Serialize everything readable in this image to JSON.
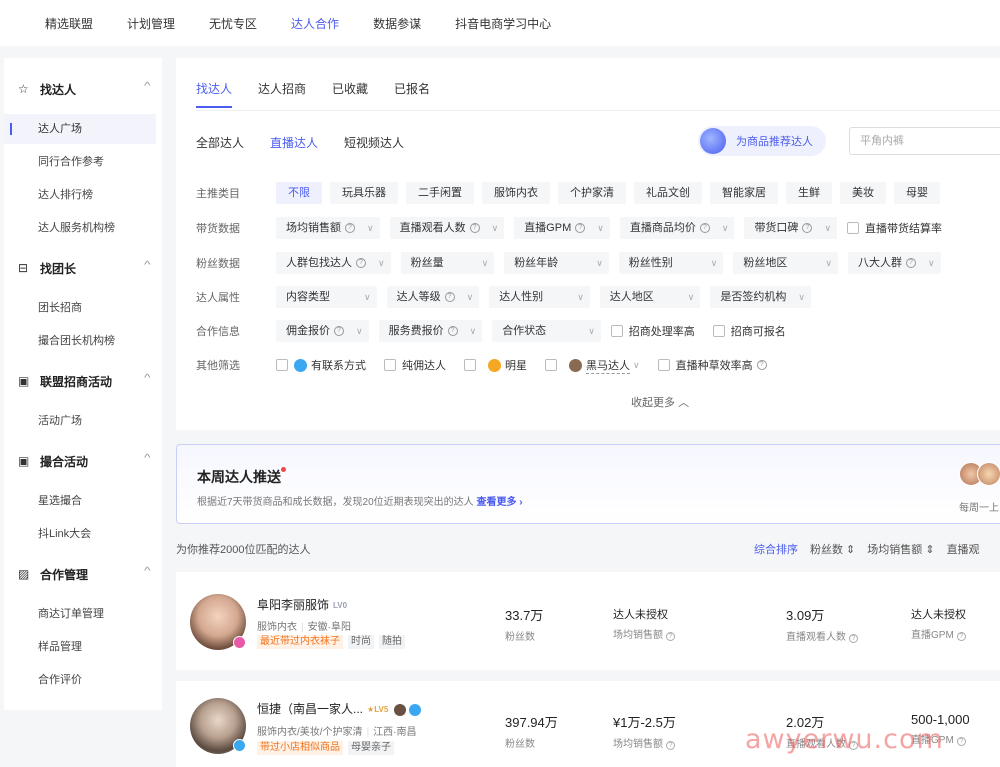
{
  "topnav": [
    "精选联盟",
    "计划管理",
    "无忧专区",
    "达人合作",
    "数据参谋",
    "抖音电商学习中心"
  ],
  "sidebar": {
    "sections": [
      {
        "label": "找达人",
        "icon": "star-icon",
        "items": [
          "达人广场",
          "同行合作参考",
          "达人排行榜",
          "达人服务机构榜"
        ]
      },
      {
        "label": "找团长",
        "icon": "shop-icon",
        "items": [
          "团长招商",
          "撮合团长机构榜"
        ]
      },
      {
        "label": "联盟招商活动",
        "icon": "activity-icon",
        "items": [
          "活动广场"
        ]
      },
      {
        "label": "撮合活动",
        "icon": "match-icon",
        "items": [
          "星选撮合",
          "抖Link大会"
        ]
      },
      {
        "label": "合作管理",
        "icon": "manage-icon",
        "items": [
          "商达订单管理",
          "样品管理",
          "合作评价"
        ]
      }
    ]
  },
  "tabs": [
    "找达人",
    "达人招商",
    "已收藏",
    "已报名"
  ],
  "subtabs": [
    "全部达人",
    "直播达人",
    "短视频达人"
  ],
  "recommend_button": "为商品推荐达人",
  "search": {
    "value": "",
    "placeholder": "平角内裤"
  },
  "filters": {
    "labels": [
      "主推类目",
      "带货数据",
      "粉丝数据",
      "达人属性",
      "合作信息",
      "其他筛选"
    ],
    "categories": [
      "不限",
      "玩具乐器",
      "二手闲置",
      "服饰内衣",
      "个护家清",
      "礼品文创",
      "智能家居",
      "生鲜",
      "美妆",
      "母婴"
    ],
    "sales": [
      "场均销售额",
      "直播观看人数",
      "直播GPM",
      "直播商品均价",
      "带货口碑"
    ],
    "sales_check": "直播带货结算率",
    "fans": [
      "人群包找达人",
      "粉丝量",
      "粉丝年龄",
      "粉丝性别",
      "粉丝地区",
      "八大人群"
    ],
    "attrs": [
      "内容类型",
      "达人等级",
      "达人性别",
      "达人地区",
      "是否签约机构"
    ],
    "coop": [
      "佣金报价",
      "服务费报价",
      "合作状态"
    ],
    "coop_checks": [
      "招商处理率高",
      "招商可报名"
    ],
    "other_checks": [
      "有联系方式",
      "纯佣达人",
      "明星",
      "黑马达人",
      "直播种草效率高"
    ],
    "collapse": "收起更多"
  },
  "weekly": {
    "title": "本周达人推送",
    "desc": "根据近7天带货商品和成长数据，发现20位近期表现突出的达人",
    "more": "查看更多 ›",
    "caption": "每周一上"
  },
  "results": {
    "count_text": "为你推荐2000位匹配的达人",
    "sorts": [
      "综合排序",
      "粉丝数 ⇕",
      "场均销售额 ⇕",
      "直播观"
    ]
  },
  "influencers": [
    {
      "name": "阜阳李丽服饰",
      "level": "LV0",
      "category": "服饰内衣",
      "location": "安徽·阜阳",
      "tags": [
        "最近带过内衣袜子",
        "时尚",
        "随拍"
      ],
      "fans": "33.7万",
      "fans_label": "粉丝数",
      "sales": "达人未授权",
      "sales_label": "场均销售额",
      "viewers": "3.09万",
      "viewers_label": "直播观看人数",
      "gpm": "达人未授权",
      "gpm_label": "直播GPM"
    },
    {
      "name": "恒捷（南昌一家人...",
      "level": "LV5",
      "category": "服饰内衣/美妆/个护家清",
      "location": "江西·南昌",
      "tags": [
        "带过小店相似商品",
        "母婴亲子"
      ],
      "fans": "397.94万",
      "fans_label": "粉丝数",
      "sales": "¥1万-2.5万",
      "sales_label": "场均销售额",
      "viewers": "2.02万",
      "viewers_label": "直播观看人数",
      "gpm": "500-1,000",
      "gpm_label": "直播GPM"
    }
  ],
  "watermark": "awyerwu.com",
  "colors": {
    "accent": "#4b5cf0",
    "hot_tag": "#f0741d",
    "watermark": "#ec5a5a"
  }
}
